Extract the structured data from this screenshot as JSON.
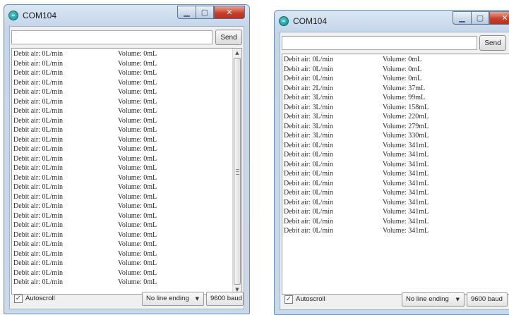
{
  "windows": [
    {
      "title": "COM104",
      "app_icon": "serial-monitor-icon",
      "send_label": "Send",
      "input_value": "",
      "autoscroll_label": "Autoscroll",
      "autoscroll_checked": true,
      "line_ending": "No line ending",
      "baud": "9600 baud",
      "lines": [
        {
          "flow": "Debit air: 0L/min",
          "volume": "Volume: 0mL"
        },
        {
          "flow": "Debit air: 0L/min",
          "volume": "Volume: 0mL"
        },
        {
          "flow": "Debit air: 0L/min",
          "volume": "Volume: 0mL"
        },
        {
          "flow": "Debit air: 0L/min",
          "volume": "Volume: 0mL"
        },
        {
          "flow": "Debit air: 0L/min",
          "volume": "Volume: 0mL"
        },
        {
          "flow": "Debit air: 0L/min",
          "volume": "Volume: 0mL"
        },
        {
          "flow": "Debit air: 0L/min",
          "volume": "Volume: 0mL"
        },
        {
          "flow": "Debit air: 0L/min",
          "volume": "Volume: 0mL"
        },
        {
          "flow": "Debit air: 0L/min",
          "volume": "Volume: 0mL"
        },
        {
          "flow": "Debit air: 0L/min",
          "volume": "Volume: 0mL"
        },
        {
          "flow": "Debit air: 0L/min",
          "volume": "Volume: 0mL"
        },
        {
          "flow": "Debit air: 0L/min",
          "volume": "Volume: 0mL"
        },
        {
          "flow": "Debit air: 0L/min",
          "volume": "Volume: 0mL"
        },
        {
          "flow": "Debit air: 0L/min",
          "volume": "Volume: 0mL"
        },
        {
          "flow": "Debit air: 0L/min",
          "volume": "Volume: 0mL"
        },
        {
          "flow": "Debit air: 0L/min",
          "volume": "Volume: 0mL"
        },
        {
          "flow": "Debit air: 0L/min",
          "volume": "Volume: 0mL"
        },
        {
          "flow": "Debit air: 0L/min",
          "volume": "Volume: 0mL"
        },
        {
          "flow": "Debit air: 0L/min",
          "volume": "Volume: 0mL"
        },
        {
          "flow": "Debit air: 0L/min",
          "volume": "Volume: 0mL"
        },
        {
          "flow": "Debit air: 0L/min",
          "volume": "Volume: 0mL"
        },
        {
          "flow": "Debit air: 0L/min",
          "volume": "Volume: 0mL"
        },
        {
          "flow": "Debit air: 0L/min",
          "volume": "Volume: 0mL"
        },
        {
          "flow": "Debit air: 0L/min",
          "volume": "Volume: 0mL"
        },
        {
          "flow": "Debit air: 0L/min",
          "volume": "Volume: 0mL"
        }
      ]
    },
    {
      "title": "COM104",
      "app_icon": "serial-monitor-icon",
      "send_label": "Send",
      "input_value": "",
      "autoscroll_label": "Autoscroll",
      "autoscroll_checked": true,
      "line_ending": "No line ending",
      "baud": "9600 baud",
      "lines": [
        {
          "flow": "Debit air: 0L/min",
          "volume": "Volume: 0mL"
        },
        {
          "flow": "Debit air: 0L/min",
          "volume": "Volume: 0mL"
        },
        {
          "flow": "Debit air: 0L/min",
          "volume": "Volume: 0mL"
        },
        {
          "flow": "Debit air: 2L/min",
          "volume": "Volume: 37mL"
        },
        {
          "flow": "Debit air: 3L/min",
          "volume": "Volume: 99mL"
        },
        {
          "flow": "Debit air: 3L/min",
          "volume": "Volume: 158mL"
        },
        {
          "flow": "Debit air: 3L/min",
          "volume": "Volume: 220mL"
        },
        {
          "flow": "Debit air: 3L/min",
          "volume": "Volume: 279mL"
        },
        {
          "flow": "Debit air: 3L/min",
          "volume": "Volume: 330mL"
        },
        {
          "flow": "Debit air: 0L/min",
          "volume": "Volume: 341mL"
        },
        {
          "flow": "Debit air: 0L/min",
          "volume": "Volume: 341mL"
        },
        {
          "flow": "Debit air: 0L/min",
          "volume": "Volume: 341mL"
        },
        {
          "flow": "Debit air: 0L/min",
          "volume": "Volume: 341mL"
        },
        {
          "flow": "Debit air: 0L/min",
          "volume": "Volume: 341mL"
        },
        {
          "flow": "Debit air: 0L/min",
          "volume": "Volume: 341mL"
        },
        {
          "flow": "Debit air: 0L/min",
          "volume": "Volume: 341mL"
        },
        {
          "flow": "Debit air: 0L/min",
          "volume": "Volume: 341mL"
        },
        {
          "flow": "Debit air: 0L/min",
          "volume": "Volume: 341mL"
        },
        {
          "flow": "Debit air: 0L/min",
          "volume": "Volume: 341mL"
        }
      ]
    }
  ]
}
